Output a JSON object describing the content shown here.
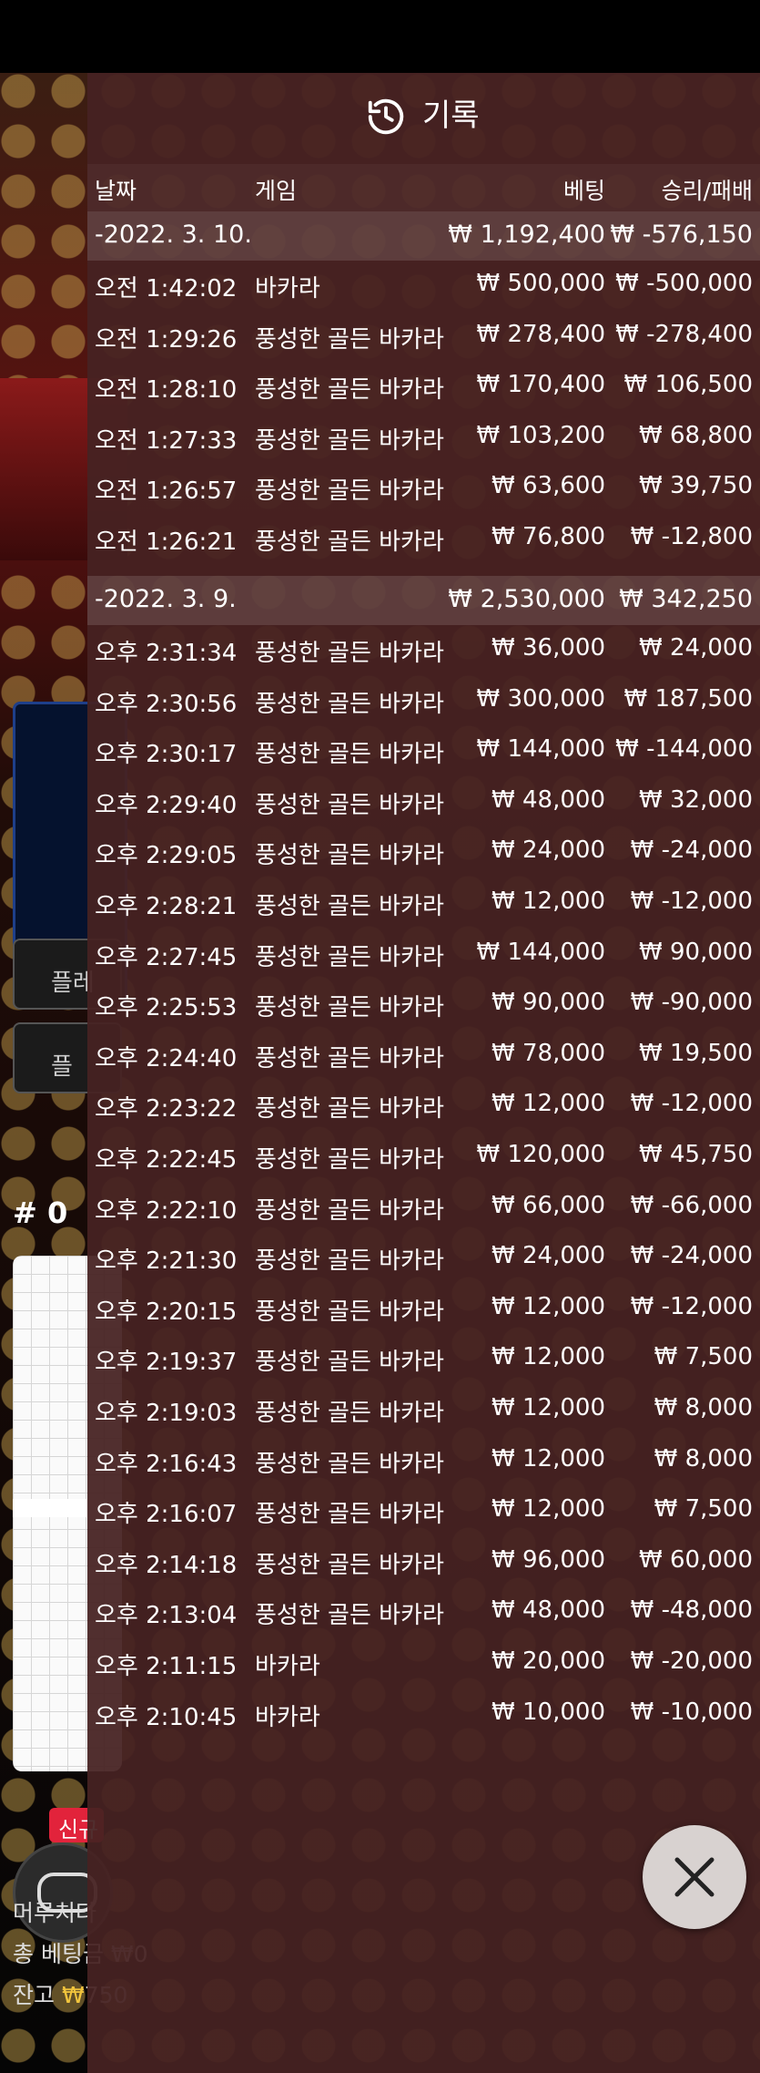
{
  "panel": {
    "title": "기록",
    "icon": "history-icon"
  },
  "columns": {
    "date": "날짜",
    "game": "게임",
    "bet": "베팅",
    "result": "승리/패배"
  },
  "groups": [
    {
      "date": "-2022. 3. 10.",
      "total_bet": "₩ 1,192,400",
      "total_result": "₩ -576,150",
      "rows": [
        {
          "time": "오전 1:42:02",
          "game": "바카라",
          "bet": "₩ 500,000",
          "result": "₩ -500,000"
        },
        {
          "time": "오전 1:29:26",
          "game": "풍성한 골든 바카라",
          "bet": "₩ 278,400",
          "result": "₩ -278,400"
        },
        {
          "time": "오전 1:28:10",
          "game": "풍성한 골든 바카라",
          "bet": "₩ 170,400",
          "result": "₩ 106,500"
        },
        {
          "time": "오전 1:27:33",
          "game": "풍성한 골든 바카라",
          "bet": "₩ 103,200",
          "result": "₩ 68,800"
        },
        {
          "time": "오전 1:26:57",
          "game": "풍성한 골든 바카라",
          "bet": "₩ 63,600",
          "result": "₩ 39,750"
        },
        {
          "time": "오전 1:26:21",
          "game": "풍성한 골든 바카라",
          "bet": "₩ 76,800",
          "result": "₩ -12,800"
        }
      ]
    },
    {
      "date": "-2022. 3. 9.",
      "total_bet": "₩ 2,530,000",
      "total_result": "₩ 342,250",
      "rows": [
        {
          "time": "오후 2:31:34",
          "game": "풍성한 골든 바카라",
          "bet": "₩ 36,000",
          "result": "₩ 24,000"
        },
        {
          "time": "오후 2:30:56",
          "game": "풍성한 골든 바카라",
          "bet": "₩ 300,000",
          "result": "₩ 187,500"
        },
        {
          "time": "오후 2:30:17",
          "game": "풍성한 골든 바카라",
          "bet": "₩ 144,000",
          "result": "₩ -144,000"
        },
        {
          "time": "오후 2:29:40",
          "game": "풍성한 골든 바카라",
          "bet": "₩ 48,000",
          "result": "₩ 32,000"
        },
        {
          "time": "오후 2:29:05",
          "game": "풍성한 골든 바카라",
          "bet": "₩ 24,000",
          "result": "₩ -24,000"
        },
        {
          "time": "오후 2:28:21",
          "game": "풍성한 골든 바카라",
          "bet": "₩ 12,000",
          "result": "₩ -12,000"
        },
        {
          "time": "오후 2:27:45",
          "game": "풍성한 골든 바카라",
          "bet": "₩ 144,000",
          "result": "₩ 90,000"
        },
        {
          "time": "오후 2:25:53",
          "game": "풍성한 골든 바카라",
          "bet": "₩ 90,000",
          "result": "₩ -90,000"
        },
        {
          "time": "오후 2:24:40",
          "game": "풍성한 골든 바카라",
          "bet": "₩ 78,000",
          "result": "₩ 19,500"
        },
        {
          "time": "오후 2:23:22",
          "game": "풍성한 골든 바카라",
          "bet": "₩ 12,000",
          "result": "₩ -12,000"
        },
        {
          "time": "오후 2:22:45",
          "game": "풍성한 골든 바카라",
          "bet": "₩ 120,000",
          "result": "₩ 45,750"
        },
        {
          "time": "오후 2:22:10",
          "game": "풍성한 골든 바카라",
          "bet": "₩ 66,000",
          "result": "₩ -66,000"
        },
        {
          "time": "오후 2:21:30",
          "game": "풍성한 골든 바카라",
          "bet": "₩ 24,000",
          "result": "₩ -24,000"
        },
        {
          "time": "오후 2:20:15",
          "game": "풍성한 골든 바카라",
          "bet": "₩ 12,000",
          "result": "₩ -12,000"
        },
        {
          "time": "오후 2:19:37",
          "game": "풍성한 골든 바카라",
          "bet": "₩ 12,000",
          "result": "₩ 7,500"
        },
        {
          "time": "오후 2:19:03",
          "game": "풍성한 골든 바카라",
          "bet": "₩ 12,000",
          "result": "₩ 8,000"
        },
        {
          "time": "오후 2:16:43",
          "game": "풍성한 골든 바카라",
          "bet": "₩ 12,000",
          "result": "₩ 8,000"
        },
        {
          "time": "오후 2:16:07",
          "game": "풍성한 골든 바카라",
          "bet": "₩ 12,000",
          "result": "₩ 7,500"
        },
        {
          "time": "오후 2:14:18",
          "game": "풍성한 골든 바카라",
          "bet": "₩ 96,000",
          "result": "₩ 60,000"
        },
        {
          "time": "오후 2:13:04",
          "game": "풍성한 골든 바카라",
          "bet": "₩ 48,000",
          "result": "₩ -48,000"
        },
        {
          "time": "오후 2:11:15",
          "game": "바카라",
          "bet": "₩ 20,000",
          "result": "₩ -20,000"
        },
        {
          "time": "오후 2:10:45",
          "game": "바카라",
          "bet": "₩ 10,000",
          "result": "₩ -10,000"
        }
      ]
    }
  ],
  "background": {
    "panel_label": "플",
    "button1_label": "플레",
    "button2_label": "플",
    "round_label": "# 0",
    "new_badge": "신규",
    "footer_line1": "머루치다",
    "footer_bet_label": "총 베팅금 ₩0",
    "footer_balance_label": "잔고",
    "footer_balance_currency": "₩",
    "footer_balance_value": "750"
  },
  "close_button": {
    "icon": "close-icon"
  },
  "colors": {
    "panel_bg": "#46222299",
    "group_bg": "#ffffff21",
    "text": "#ffffff",
    "close_bg": "#d8d2d0"
  }
}
